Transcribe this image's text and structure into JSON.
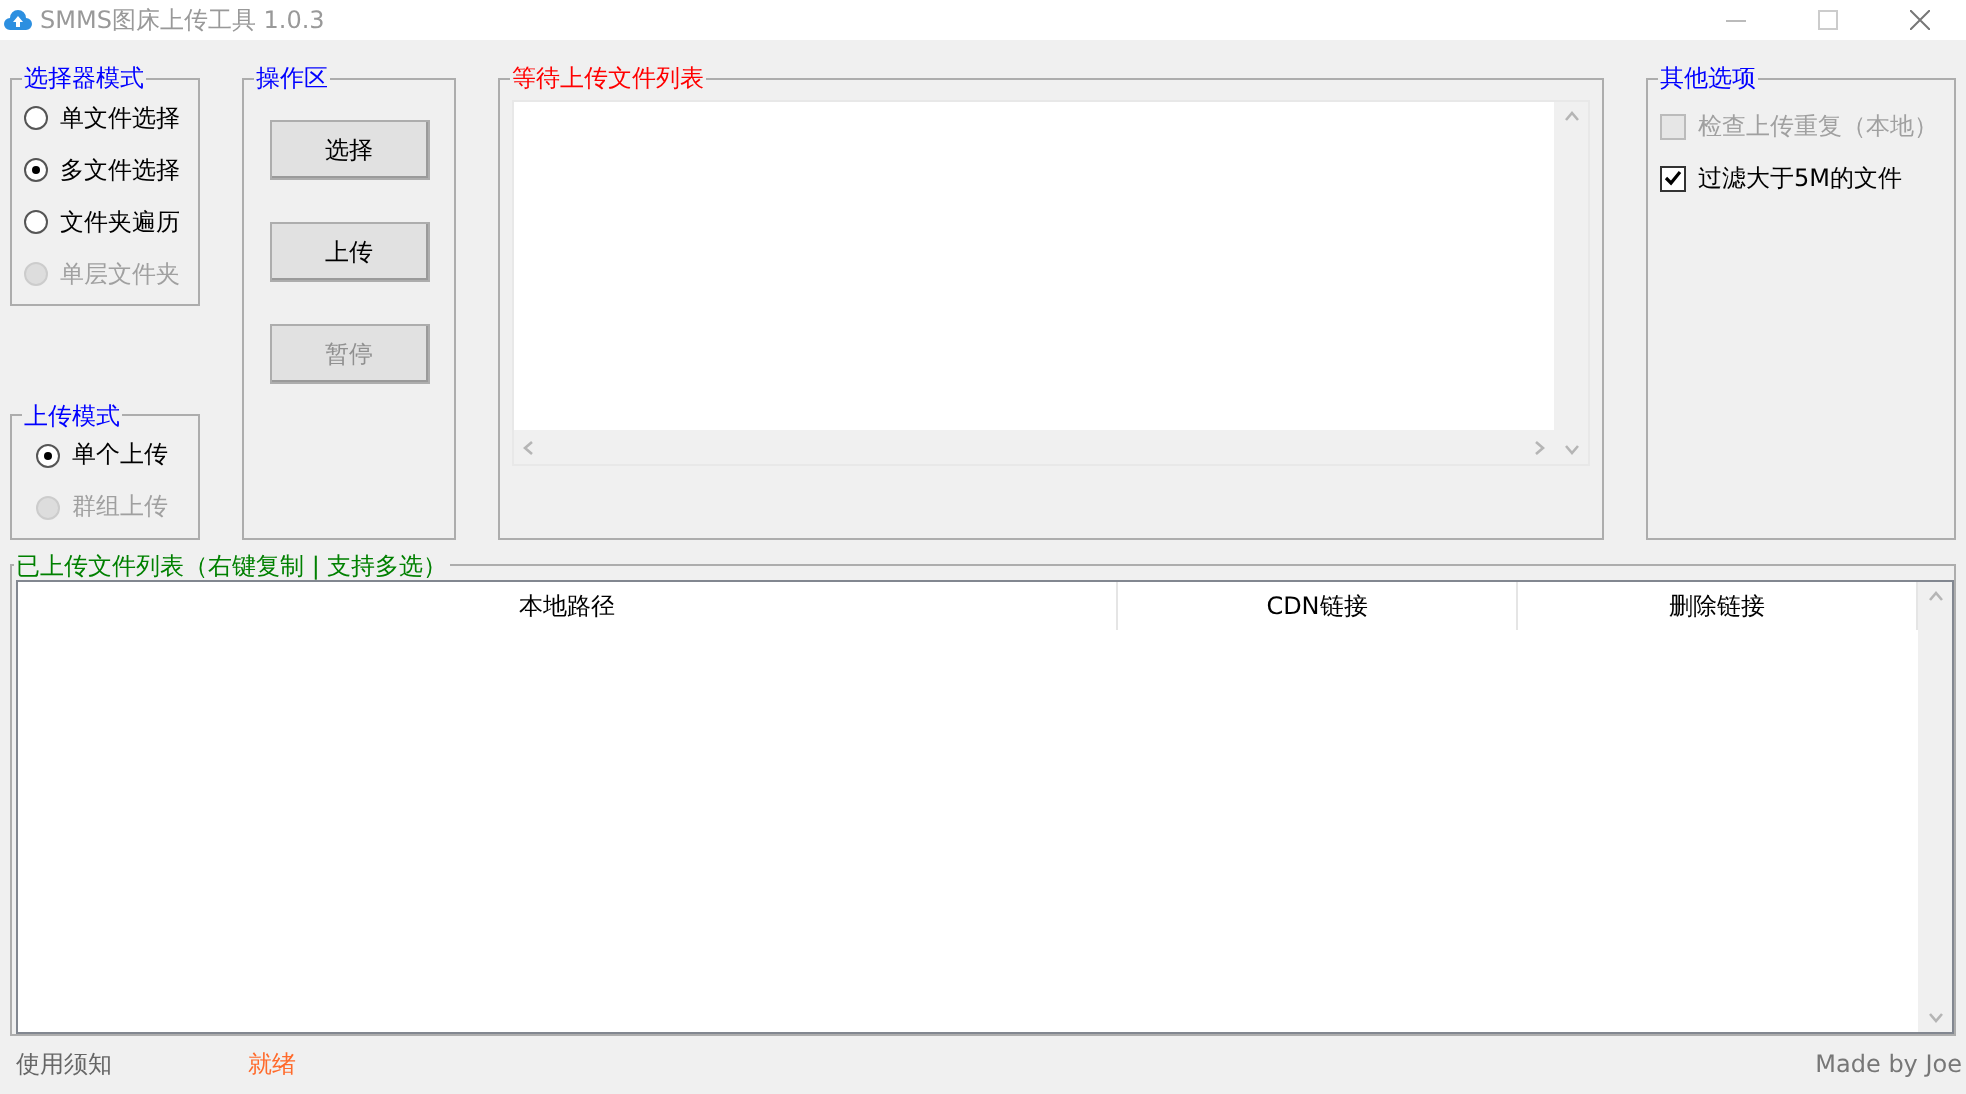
{
  "window": {
    "title": "SMMS图床上传工具 1.0.3"
  },
  "selector_mode": {
    "title": "选择器模式",
    "options": [
      {
        "label": "单文件选择",
        "selected": false,
        "disabled": false
      },
      {
        "label": "多文件选择",
        "selected": true,
        "disabled": false
      },
      {
        "label": "文件夹遍历",
        "selected": false,
        "disabled": false
      },
      {
        "label": "单层文件夹",
        "selected": false,
        "disabled": true
      }
    ]
  },
  "upload_mode": {
    "title": "上传模式",
    "options": [
      {
        "label": "单个上传",
        "selected": true,
        "disabled": false
      },
      {
        "label": "群组上传",
        "selected": false,
        "disabled": true
      }
    ]
  },
  "actions": {
    "title": "操作区",
    "buttons": [
      {
        "label": "选择",
        "disabled": false
      },
      {
        "label": "上传",
        "disabled": false
      },
      {
        "label": "暂停",
        "disabled": true
      }
    ]
  },
  "pending": {
    "title": "等待上传文件列表"
  },
  "other_options": {
    "title": "其他选项",
    "options": [
      {
        "label": "检查上传重复（本地）",
        "checked": false,
        "disabled": true
      },
      {
        "label": "过滤大于5M的文件",
        "checked": true,
        "disabled": false
      }
    ]
  },
  "uploaded": {
    "title": "已上传文件列表（右键复制 | 支持多选）",
    "columns": [
      "本地路径",
      "CDN链接",
      "删除链接"
    ]
  },
  "status_bar": {
    "help": "使用须知",
    "status": "就绪",
    "credit": "Made by Joe"
  }
}
